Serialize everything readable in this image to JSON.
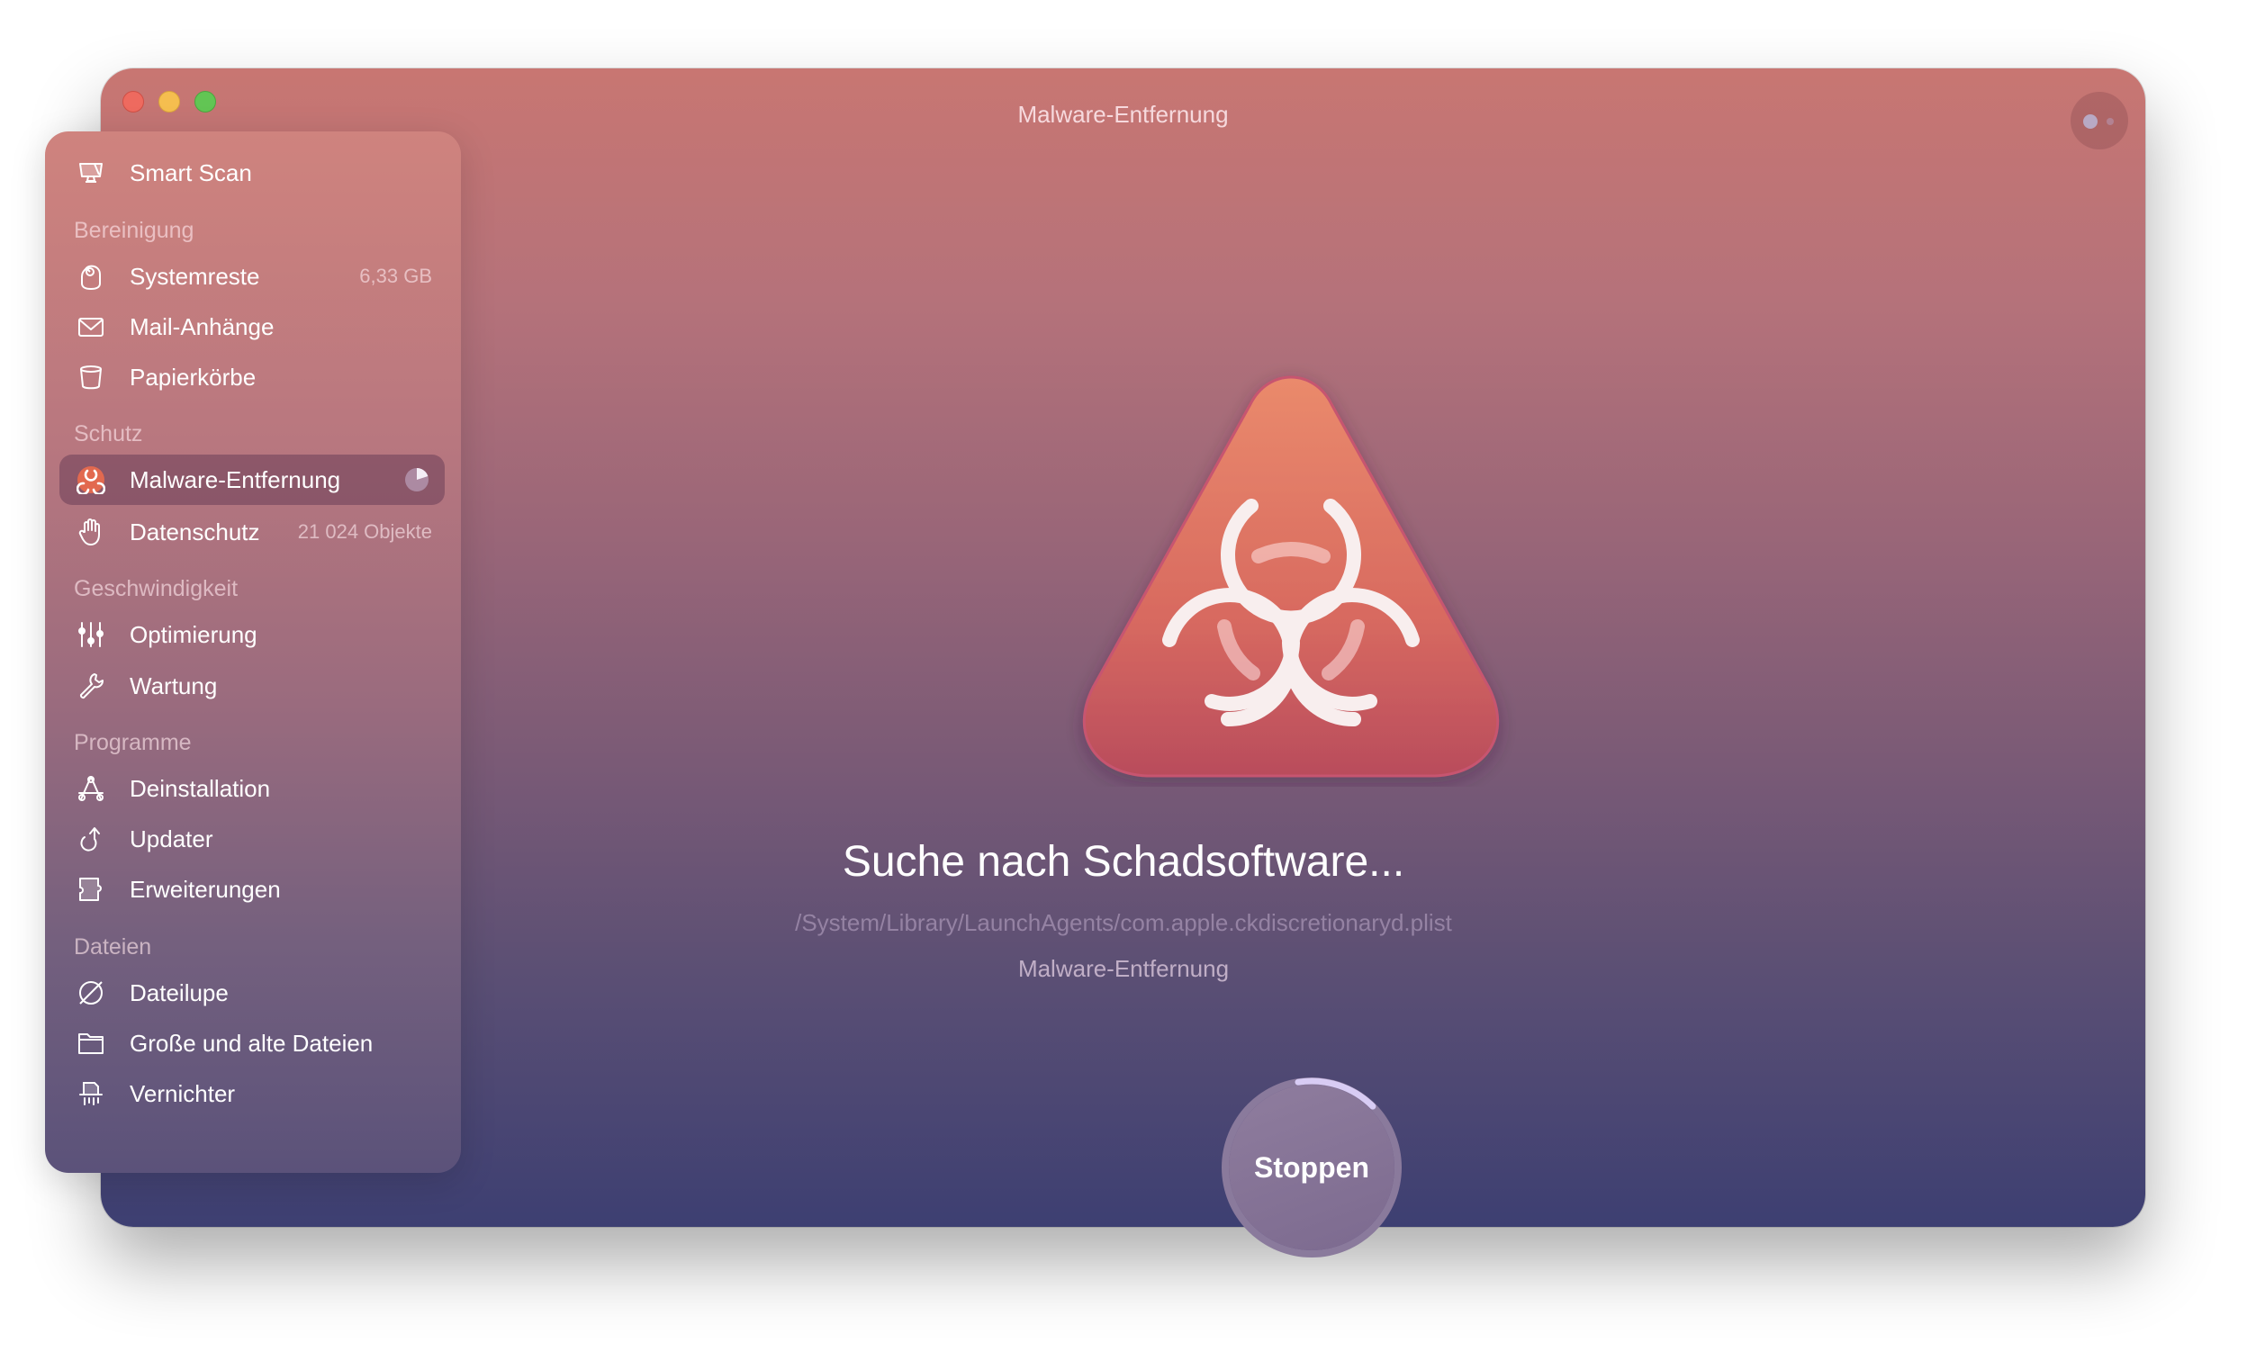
{
  "window": {
    "title": "Malware-Entfernung",
    "traffic_lights": [
      "close",
      "minimize",
      "zoom"
    ],
    "assistant_icon": "assistant-dots-icon"
  },
  "sidebar": {
    "top_item": {
      "label": "Smart Scan",
      "icon": "monitor-icon"
    },
    "sections": [
      {
        "title": "Bereinigung",
        "items": [
          {
            "label": "Systemreste",
            "icon": "system-junk-icon",
            "meta": "6,33 GB"
          },
          {
            "label": "Mail-Anhänge",
            "icon": "envelope-icon",
            "meta": ""
          },
          {
            "label": "Papierkörbe",
            "icon": "trash-bin-icon",
            "meta": ""
          }
        ]
      },
      {
        "title": "Schutz",
        "items": [
          {
            "label": "Malware-Entfernung",
            "icon": "biohazard-icon",
            "meta": "",
            "active": true,
            "progress": 0.2
          },
          {
            "label": "Datenschutz",
            "icon": "hand-icon",
            "meta": "21 024 Objekte"
          }
        ]
      },
      {
        "title": "Geschwindigkeit",
        "items": [
          {
            "label": "Optimierung",
            "icon": "sliders-icon",
            "meta": ""
          },
          {
            "label": "Wartung",
            "icon": "wrench-icon",
            "meta": ""
          }
        ]
      },
      {
        "title": "Programme",
        "items": [
          {
            "label": "Deinstallation",
            "icon": "app-uninstall-icon",
            "meta": ""
          },
          {
            "label": "Updater",
            "icon": "update-arrow-icon",
            "meta": ""
          },
          {
            "label": "Erweiterungen",
            "icon": "puzzle-icon",
            "meta": ""
          }
        ]
      },
      {
        "title": "Dateien",
        "items": [
          {
            "label": "Dateilupe",
            "icon": "space-lens-icon",
            "meta": ""
          },
          {
            "label": "Große und alte Dateien",
            "icon": "folder-icon",
            "meta": ""
          },
          {
            "label": "Vernichter",
            "icon": "shredder-icon",
            "meta": ""
          }
        ]
      }
    ]
  },
  "main": {
    "icon": "biohazard-triangle-icon",
    "headline": "Suche nach Schadsoftware...",
    "current_path": "/System/Library/LaunchAgents/com.apple.ckdiscretionaryd.plist",
    "subtitle": "Malware-Entfernung",
    "stop_button": "Stoppen",
    "scan_progress": 0.15
  },
  "colors": {
    "bg_top": "#c87672",
    "bg_bottom": "#3d3f72",
    "icon_orange": "#e8876a",
    "icon_red": "#b84a5a",
    "progress_ring": "#d8ccf4"
  }
}
